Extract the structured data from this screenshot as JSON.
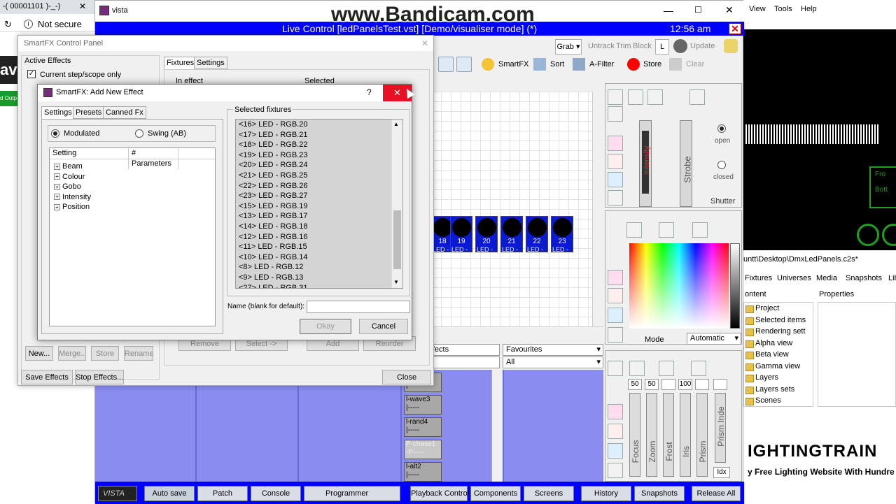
{
  "browser": {
    "tab_title": "-( 00001101 )-_-)",
    "nav_secure": "Not secure",
    "page_snippet_1": "av",
    "page_snippet_2": "d Outp"
  },
  "watermark": "www.Bandicam.com",
  "vista": {
    "window_title": "vista",
    "live_bar": "Live Control [ledPanelsTest.vst] [Demo/visualiser mode] (*)",
    "clock": "12:56 am",
    "toolbar1": {
      "grab": "Grab",
      "untrack": "Untrack",
      "trim": "Trim",
      "block": "Block",
      "l": "L",
      "update": "Update"
    },
    "toolbar2": {
      "smartfx": "SmartFX",
      "sort": "Sort",
      "afilter": "A-Filter",
      "store": "Store",
      "clear": "Clear"
    },
    "fixtures": [
      {
        "num": "18",
        "lbl": "LED -"
      },
      {
        "num": "19",
        "lbl": "LED -"
      },
      {
        "num": "20",
        "lbl": "LED -"
      },
      {
        "num": "21",
        "lbl": "LED -"
      },
      {
        "num": "22",
        "lbl": "LED -"
      },
      {
        "num": "23",
        "lbl": "LED -"
      }
    ],
    "effects_label": "ffects",
    "favourites_label": "Favourites",
    "favourites_filter": "All",
    "chases": [
      {
        "name": "-3",
        "sub": "|-----"
      },
      {
        "name": "l-wave3",
        "sub": "|-----"
      },
      {
        "name": "l-rand4",
        "sub": "|-----"
      },
      {
        "name": "P-chase1",
        "sub": "-P-----"
      },
      {
        "name": "l-alt2",
        "sub": "|-----"
      }
    ],
    "beam": {
      "open": "open",
      "closed": "closed",
      "shutter": "Shutter",
      "intensity": "Intensity",
      "strobe": "Strobe"
    },
    "colour": {
      "mode": "Mode",
      "mode_value": "Automatic"
    },
    "lens": {
      "values": [
        "50",
        "50",
        "",
        "100",
        "",
        ""
      ],
      "labels": [
        "Focus",
        "Zoom",
        "Frost",
        "Iris",
        "Prism",
        "Prism Inde"
      ],
      "idx": "Idx"
    },
    "bottom_bar": [
      "Auto save",
      "Patch",
      "Console",
      "Programmer",
      "Playback Control",
      "Components",
      "Screens",
      "History",
      "Snapshots",
      "Release All"
    ],
    "logo": "VISTA"
  },
  "control_panel": {
    "title": "SmartFX Control Panel",
    "active_effects": "Active Effects",
    "current_step": "Current step/scope only",
    "tabs": [
      "Fixtures",
      "Settings"
    ],
    "in_effect": "In effect",
    "selected": "Selected",
    "buttons": {
      "new": "New...",
      "merge": "Merge...",
      "store": "Store",
      "rename": "Rename",
      "remove": "Remove",
      "select": "Select ->",
      "add": "Add",
      "reorder": "Reorder",
      "save_effects": "Save Effects",
      "stop_effects": "Stop Effects...",
      "close": "Close"
    }
  },
  "dialog": {
    "title": "SmartFX: Add New Effect",
    "help": "?",
    "tabs": [
      "Settings",
      "Presets",
      "Canned Fx"
    ],
    "modulated": "Modulated",
    "swing": "Swing (AB)",
    "col_setting": "Setting",
    "col_params": "# Parameters",
    "tree": [
      "Beam",
      "Colour",
      "Gobo",
      "Intensity",
      "Position"
    ],
    "selected_fixtures_label": "Selected fixtures",
    "fixtures": [
      "<16> LED - RGB.20",
      "<17> LED - RGB.21",
      "<18> LED - RGB.22",
      "<19> LED - RGB.23",
      "<20> LED - RGB.24",
      "<21> LED - RGB.25",
      "<22> LED - RGB.26",
      "<23> LED - RGB.27",
      "<15> LED - RGB.19",
      "<13> LED - RGB.17",
      "<14> LED - RGB.18",
      "<12> LED - RGB.16",
      "<11> LED - RGB.15",
      "<10> LED - RGB.14",
      "<8> LED - RGB.12",
      "<9> LED - RGB.13",
      "<27> LED - RGB.31"
    ],
    "name_label": "Name (blank for default):",
    "okay": "Okay",
    "cancel": "Cancel"
  },
  "right_app": {
    "menu": [
      "View",
      "Tools",
      "Help"
    ],
    "path": "untt\\Desktop\\DmxLedPanels.c2s*",
    "tabs": [
      "Fixtures",
      "Universes",
      "Media",
      "Snapshots",
      "Lib"
    ],
    "content_label": "ontent",
    "properties_label": "Properties",
    "tree": [
      "Project",
      "Selected items",
      "Rendering sett",
      "Alpha view",
      "Beta view",
      "Gamma view",
      "Layers",
      "Layers sets",
      "Scenes"
    ],
    "vis_labels": [
      "Fro",
      "Bott"
    ],
    "banner": "IGHTINGTRAIN",
    "banner_sub": "y Free Lighting Website With Hundre"
  },
  "colors": {
    "vista_blue": "#0000ff",
    "fixture_blue": "#0a1ad0",
    "playback_bg": "#8a8cf0",
    "close_red": "#e81123",
    "store_red": "#ff0000"
  }
}
